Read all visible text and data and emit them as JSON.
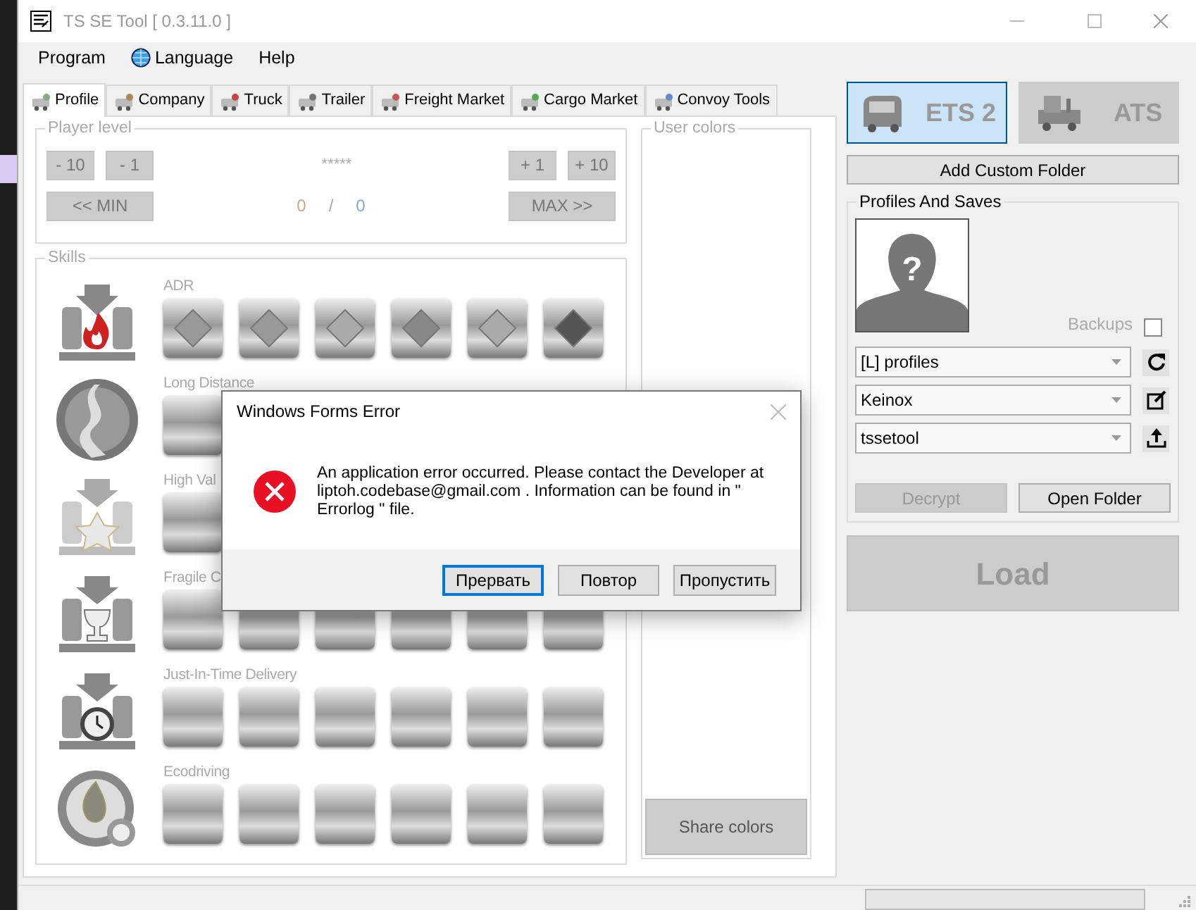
{
  "window": {
    "title": "TS SE Tool [ 0.3.11.0 ]"
  },
  "menu": [
    "Program",
    "Language",
    "Help"
  ],
  "tabs": [
    {
      "label": "Profile",
      "selected": true
    },
    {
      "label": "Company",
      "selected": false
    },
    {
      "label": "Truck",
      "selected": false
    },
    {
      "label": "Trailer",
      "selected": false
    },
    {
      "label": "Freight Market",
      "selected": false
    },
    {
      "label": "Cargo Market",
      "selected": false
    },
    {
      "label": "Convoy Tools",
      "selected": false
    }
  ],
  "player_level": {
    "title": "Player level",
    "buttons_left": [
      "- 10",
      "- 1"
    ],
    "stars": "*****",
    "buttons_right": [
      "+ 1",
      "+ 10"
    ],
    "min_button": "<< MIN",
    "max_button": "MAX >>",
    "current": "0",
    "separator": "/",
    "total": "0"
  },
  "skills": {
    "title": "Skills",
    "items": [
      {
        "kind": "adr",
        "label": "ADR"
      },
      {
        "kind": "long_distance",
        "label": "Long Distance"
      },
      {
        "kind": "high_value",
        "label": "High Val"
      },
      {
        "kind": "fragile",
        "label": "Fragile C"
      },
      {
        "kind": "just_in_time",
        "label": "Just-In-Time Delivery"
      },
      {
        "kind": "ecodriving",
        "label": "Ecodriving"
      }
    ]
  },
  "user_colors": {
    "title": "User colors",
    "share_button": "Share colors"
  },
  "games": [
    {
      "label": "ETS 2",
      "selected": true
    },
    {
      "label": "ATS",
      "selected": false
    }
  ],
  "add_custom_folder": "Add Custom Folder",
  "profiles": {
    "title": "Profiles And Saves",
    "avatar_mark": "?",
    "backups": {
      "label": "Backups",
      "checked": false
    },
    "dropdowns": [
      {
        "kind": "refresh",
        "value": "[L] profiles"
      },
      {
        "kind": "edit",
        "value": "Keinox"
      },
      {
        "kind": "export",
        "value": "tssetool"
      }
    ],
    "decrypt": {
      "label": "Decrypt",
      "disabled": true
    },
    "open_folder": {
      "label": "Open Folder",
      "disabled": false
    }
  },
  "load": {
    "label": "Load",
    "disabled": true
  },
  "status_bar": {
    "progress": {
      "level": 0
    }
  },
  "dialog": {
    "title": "Windows Forms Error",
    "message": "An application error occurred. Please contact the Developer at liptoh.codebase@gmail.com . Information can be found in \" Errorlog \" file.",
    "buttons": [
      {
        "label": "Прервать",
        "selected": true
      },
      {
        "label": "Повтор",
        "selected": false
      },
      {
        "label": "Пропустить",
        "selected": false
      }
    ]
  }
}
